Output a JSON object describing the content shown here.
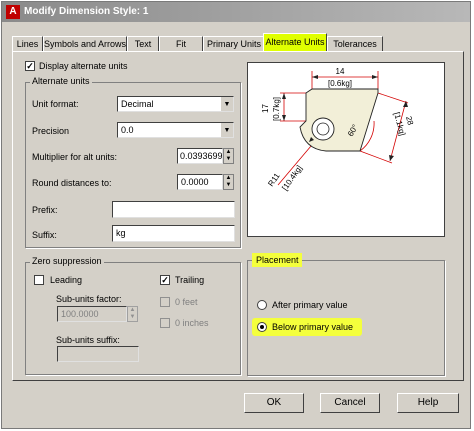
{
  "window": {
    "title": "Modify Dimension Style: 1",
    "app_icon": "A"
  },
  "tabs": [
    {
      "label": "Lines"
    },
    {
      "label": "Symbols and Arrows"
    },
    {
      "label": "Text"
    },
    {
      "label": "Fit"
    },
    {
      "label": "Primary Units"
    },
    {
      "label": "Alternate Units",
      "active": true
    },
    {
      "label": "Tolerances"
    }
  ],
  "display_alternate_units": {
    "label": "Display alternate units",
    "checked": true
  },
  "alternate_units": {
    "group_label": "Alternate units",
    "unit_format": {
      "label": "Unit format:",
      "value": "Decimal"
    },
    "precision": {
      "label": "Precision",
      "value": "0.0"
    },
    "multiplier": {
      "label": "Multiplier for alt units:",
      "value": "0.03936996"
    },
    "round": {
      "label": "Round distances  to:",
      "value": "0.0000"
    },
    "prefix": {
      "label": "Prefix:",
      "value": ""
    },
    "suffix": {
      "label": "Suffix:",
      "value": "kg"
    }
  },
  "zero_suppression": {
    "group_label": "Zero suppression",
    "leading": {
      "label": "Leading",
      "checked": false
    },
    "trailing": {
      "label": "Trailing",
      "checked": true
    },
    "sub_units_factor": {
      "label": "Sub-units factor:",
      "value": "100.0000"
    },
    "sub_units_suffix": {
      "label": "Sub-units suffix:",
      "value": ""
    },
    "zero_feet": {
      "label": "0 feet",
      "checked": false
    },
    "zero_inches": {
      "label": "0 inches",
      "checked": false
    }
  },
  "placement": {
    "group_label": "Placement",
    "after_primary": {
      "label": "After primary value",
      "selected": false
    },
    "below_primary": {
      "label": "Below primary value",
      "selected": true
    }
  },
  "preview": {
    "dim_top": "14",
    "dim_top_alt": "[0.6kg]",
    "dim_left": "17",
    "dim_left_alt": "[0.7kg]",
    "dim_right": "28",
    "dim_right_alt": "[1.1kg]",
    "dim_angle": "60°",
    "dim_radius": "R11",
    "dim_radius_alt": "[10.4kg]"
  },
  "buttons": {
    "ok": "OK",
    "cancel": "Cancel",
    "help": "Help"
  },
  "colors": {
    "highlight": "#f4ff3c",
    "preview_dim": "#d40000",
    "preview_shape": "#f2efd8",
    "window_bg": "#d4d0c8"
  }
}
